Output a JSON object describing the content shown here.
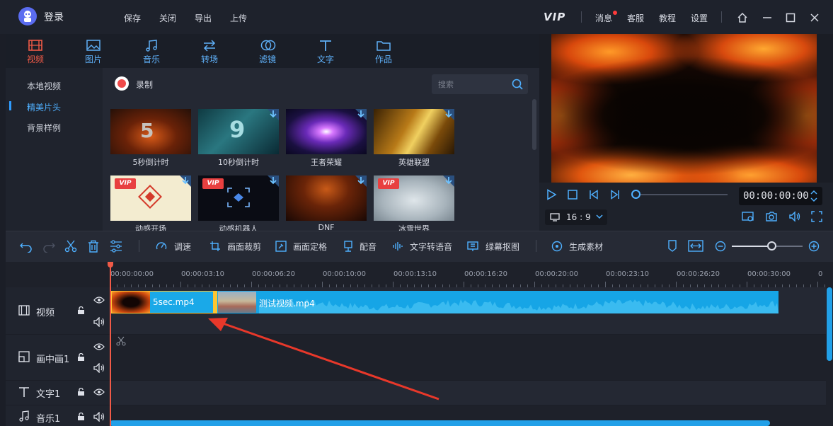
{
  "header": {
    "login_label": "登录",
    "menu": [
      "保存",
      "关闭",
      "导出",
      "上传"
    ],
    "vip_label": "VIP",
    "right_menu": [
      "消息",
      "客服",
      "教程",
      "设置"
    ]
  },
  "tabs": [
    {
      "label": "视频",
      "icon": "film-icon",
      "active": true
    },
    {
      "label": "图片",
      "icon": "image-icon",
      "active": false
    },
    {
      "label": "音乐",
      "icon": "music-icon",
      "active": false
    },
    {
      "label": "转场",
      "icon": "transition-icon",
      "active": false
    },
    {
      "label": "滤镜",
      "icon": "filter-icon",
      "active": false
    },
    {
      "label": "文字",
      "icon": "text-icon",
      "active": false
    },
    {
      "label": "作品",
      "icon": "folder-icon",
      "active": false
    }
  ],
  "categories": [
    {
      "label": "本地视频",
      "active": false
    },
    {
      "label": "精美片头",
      "active": true
    },
    {
      "label": "背景样例",
      "active": false
    }
  ],
  "record_label": "录制",
  "search": {
    "placeholder": "搜索"
  },
  "thumbnails": [
    {
      "label": "5秒倒计时",
      "vip": false,
      "download": false,
      "overlay_text": "5"
    },
    {
      "label": "10秒倒计时",
      "vip": false,
      "download": true,
      "overlay_text": "9"
    },
    {
      "label": "王者荣耀",
      "vip": false,
      "download": true,
      "overlay_text": ""
    },
    {
      "label": "英雄联盟",
      "vip": false,
      "download": true,
      "overlay_text": ""
    },
    {
      "label": "动感开场",
      "vip": true,
      "download": true,
      "overlay_text": ""
    },
    {
      "label": "动感机器人",
      "vip": true,
      "download": true,
      "overlay_text": ""
    },
    {
      "label": "DNF",
      "vip": false,
      "download": true,
      "overlay_text": ""
    },
    {
      "label": "冰雪世界",
      "vip": true,
      "download": true,
      "overlay_text": ""
    }
  ],
  "vip_badge": "VIP",
  "preview": {
    "timecode": "00:00:00:00",
    "ratio": "16 : 9",
    "progress": 0
  },
  "toolbar": {
    "tools": [
      "调速",
      "画面裁剪",
      "画面定格",
      "配音",
      "文字转语音",
      "绿幕抠图",
      "生成素材"
    ]
  },
  "timeline": {
    "ticks": [
      "00:00:00:00",
      "00:00:03:10",
      "00:00:06:20",
      "00:00:10:00",
      "00:00:13:10",
      "00:00:16:20",
      "00:00:20:00",
      "00:00:23:10",
      "00:00:26:20",
      "00:00:30:00",
      "0"
    ],
    "tracks": [
      {
        "name": "视频",
        "icon": "film-icon"
      },
      {
        "name": "画中画1",
        "icon": "pip-icon"
      },
      {
        "name": "文字1",
        "icon": "text-icon"
      },
      {
        "name": "音乐1",
        "icon": "music-icon"
      }
    ],
    "clips": [
      {
        "name": "5sec.mp4"
      },
      {
        "name": "测试视频.mp4"
      }
    ],
    "zoom_level": 0.56
  },
  "colors": {
    "accent": "#1aa9e8",
    "active_tab": "#f05a47",
    "tab_icon": "#5fb0f8",
    "playhead": "#f05a47",
    "selection": "#ffc530"
  }
}
